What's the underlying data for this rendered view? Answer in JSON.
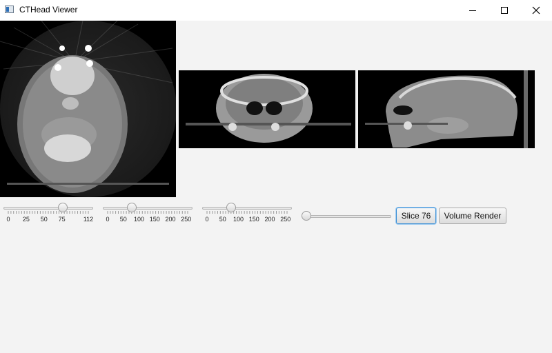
{
  "window": {
    "title": "CTHead Viewer",
    "icon": "app-window-icon",
    "controls": [
      "minimize-icon",
      "maximize-icon",
      "close-icon"
    ]
  },
  "views": {
    "axial": {
      "name": "axial-slice-view"
    },
    "coronal": {
      "name": "coronal-slice-view"
    },
    "sagittal": {
      "name": "sagittal-slice-view"
    }
  },
  "sliders": [
    {
      "id": "axial",
      "min": 0,
      "max": 112,
      "value": 76,
      "labels": [
        "0",
        "25",
        "50",
        "75",
        "112"
      ],
      "label_values": [
        0,
        25,
        50,
        75,
        112
      ]
    },
    {
      "id": "coronal",
      "min": 0,
      "max": 255,
      "value": 76,
      "labels": [
        "0",
        "50",
        "100",
        "150",
        "200",
        "250"
      ],
      "label_values": [
        0,
        50,
        100,
        150,
        200,
        250
      ]
    },
    {
      "id": "sagittal",
      "min": 0,
      "max": 255,
      "value": 76,
      "labels": [
        "0",
        "50",
        "100",
        "150",
        "200",
        "250"
      ],
      "label_values": [
        0,
        50,
        100,
        150,
        200,
        250
      ]
    },
    {
      "id": "extra",
      "min": 0,
      "max": 100,
      "value": 0,
      "labels": [],
      "label_values": []
    }
  ],
  "buttons": {
    "slice_label": "Slice 76",
    "volume_label": "Volume Render"
  },
  "colors": {
    "focus": "#3a8fd6",
    "background": "#f3f3f3"
  }
}
